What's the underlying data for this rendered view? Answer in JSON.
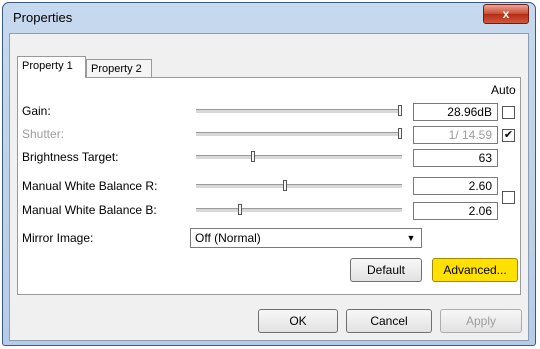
{
  "window": {
    "title": "Properties",
    "close_glyph": "x"
  },
  "tabs": [
    {
      "label": "Property 1",
      "active": true
    },
    {
      "label": "Property 2",
      "active": false
    }
  ],
  "auto_header": "Auto",
  "rows": {
    "gain": {
      "label": "Gain:",
      "value": "28.96dB",
      "level": 1.0
    },
    "shutter": {
      "label": "Shutter:",
      "value": "1/ 14.59",
      "level": 1.0,
      "auto_checked": "✔"
    },
    "brightness": {
      "label": "Brightness Target:",
      "value": "63",
      "level": 0.27
    },
    "wb_r": {
      "label": "Manual White Balance R:",
      "value": "2.60",
      "level": 0.43
    },
    "wb_b": {
      "label": "Manual White Balance B:",
      "value": "2.06",
      "level": 0.21
    }
  },
  "mirror": {
    "label": "Mirror Image:",
    "value": "Off (Normal)",
    "arrow_glyph": "▼"
  },
  "buttons": {
    "default": "Default",
    "advanced": "Advanced...",
    "ok": "OK",
    "cancel": "Cancel",
    "apply": "Apply"
  },
  "colors": {
    "advanced_highlight": "#ffe000",
    "close_red": "#c8432c"
  }
}
